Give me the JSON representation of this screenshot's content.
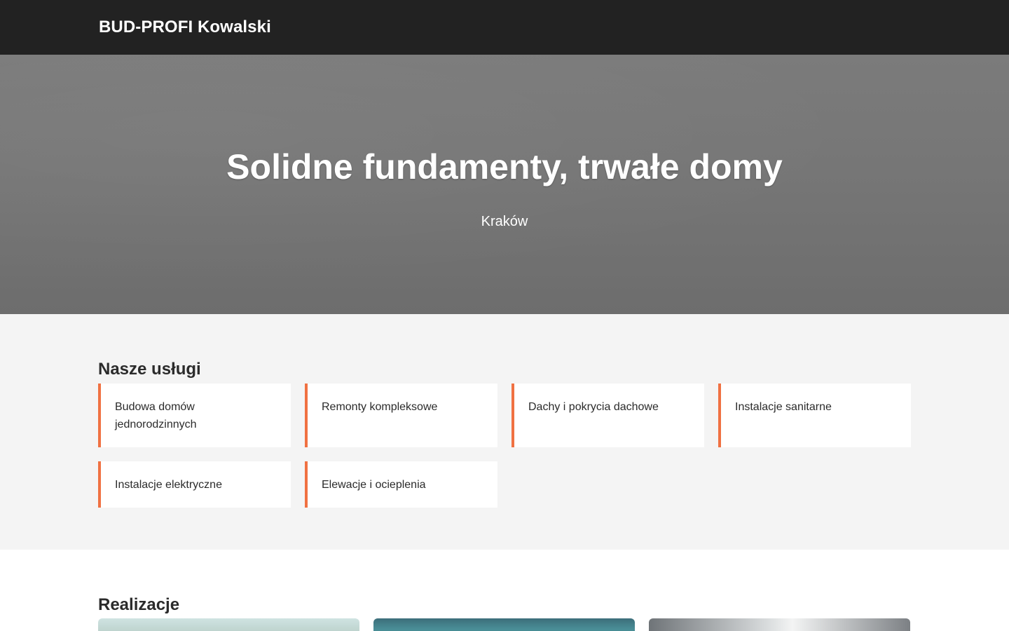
{
  "header": {
    "brand": "BUD-PROFI Kowalski"
  },
  "hero": {
    "title": "Solidne fundamenty, trwałe domy",
    "city": "Kraków"
  },
  "services": {
    "title": "Nasze usługi",
    "items": [
      {
        "label": "Budowa domów jednorodzinnych"
      },
      {
        "label": "Remonty kompleksowe"
      },
      {
        "label": "Dachy i pokrycia dachowe"
      },
      {
        "label": "Instalacje sanitarne"
      },
      {
        "label": "Instalacje elektryczne"
      },
      {
        "label": "Elewacje i ocieplenia"
      }
    ]
  },
  "realizations": {
    "title": "Realizacje"
  },
  "colors": {
    "header_bg": "#222222",
    "accent": "#f07142",
    "services_bg": "#f4f4f4"
  }
}
